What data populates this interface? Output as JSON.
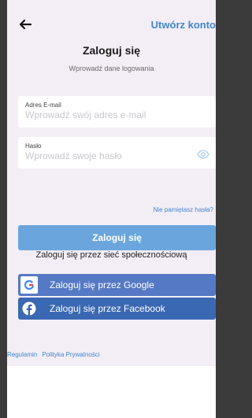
{
  "header": {
    "back_icon": "arrow-left-icon",
    "create_account": "Utwórz konto"
  },
  "title": "Zaloguj się",
  "subtitle": "Wprowadź dane logowania",
  "email": {
    "label": "Adres E-mail",
    "placeholder": "Wprowadź swój adres e-mail",
    "value": ""
  },
  "password": {
    "label": "Hasło",
    "placeholder": "Wprowadź swoje hasło",
    "value": "",
    "visibility_icon": "eye-icon"
  },
  "forgot_password": "Nie pamiętasz hasła?",
  "login_button": "Zaloguj się",
  "social": {
    "caption": "Zaloguj się przez sieć społecznościową",
    "google": "Zaloguj się przez Google",
    "facebook": "Zaloguj się przez Facebook"
  },
  "footer": {
    "terms": "Regulamin",
    "privacy": "Polityka Prywatności"
  },
  "colors": {
    "accent": "#3f86cf",
    "login_button": "#6aa6dd",
    "google_button": "#5579c4",
    "facebook_button": "#3a68b3",
    "background": "#f3eef6"
  }
}
